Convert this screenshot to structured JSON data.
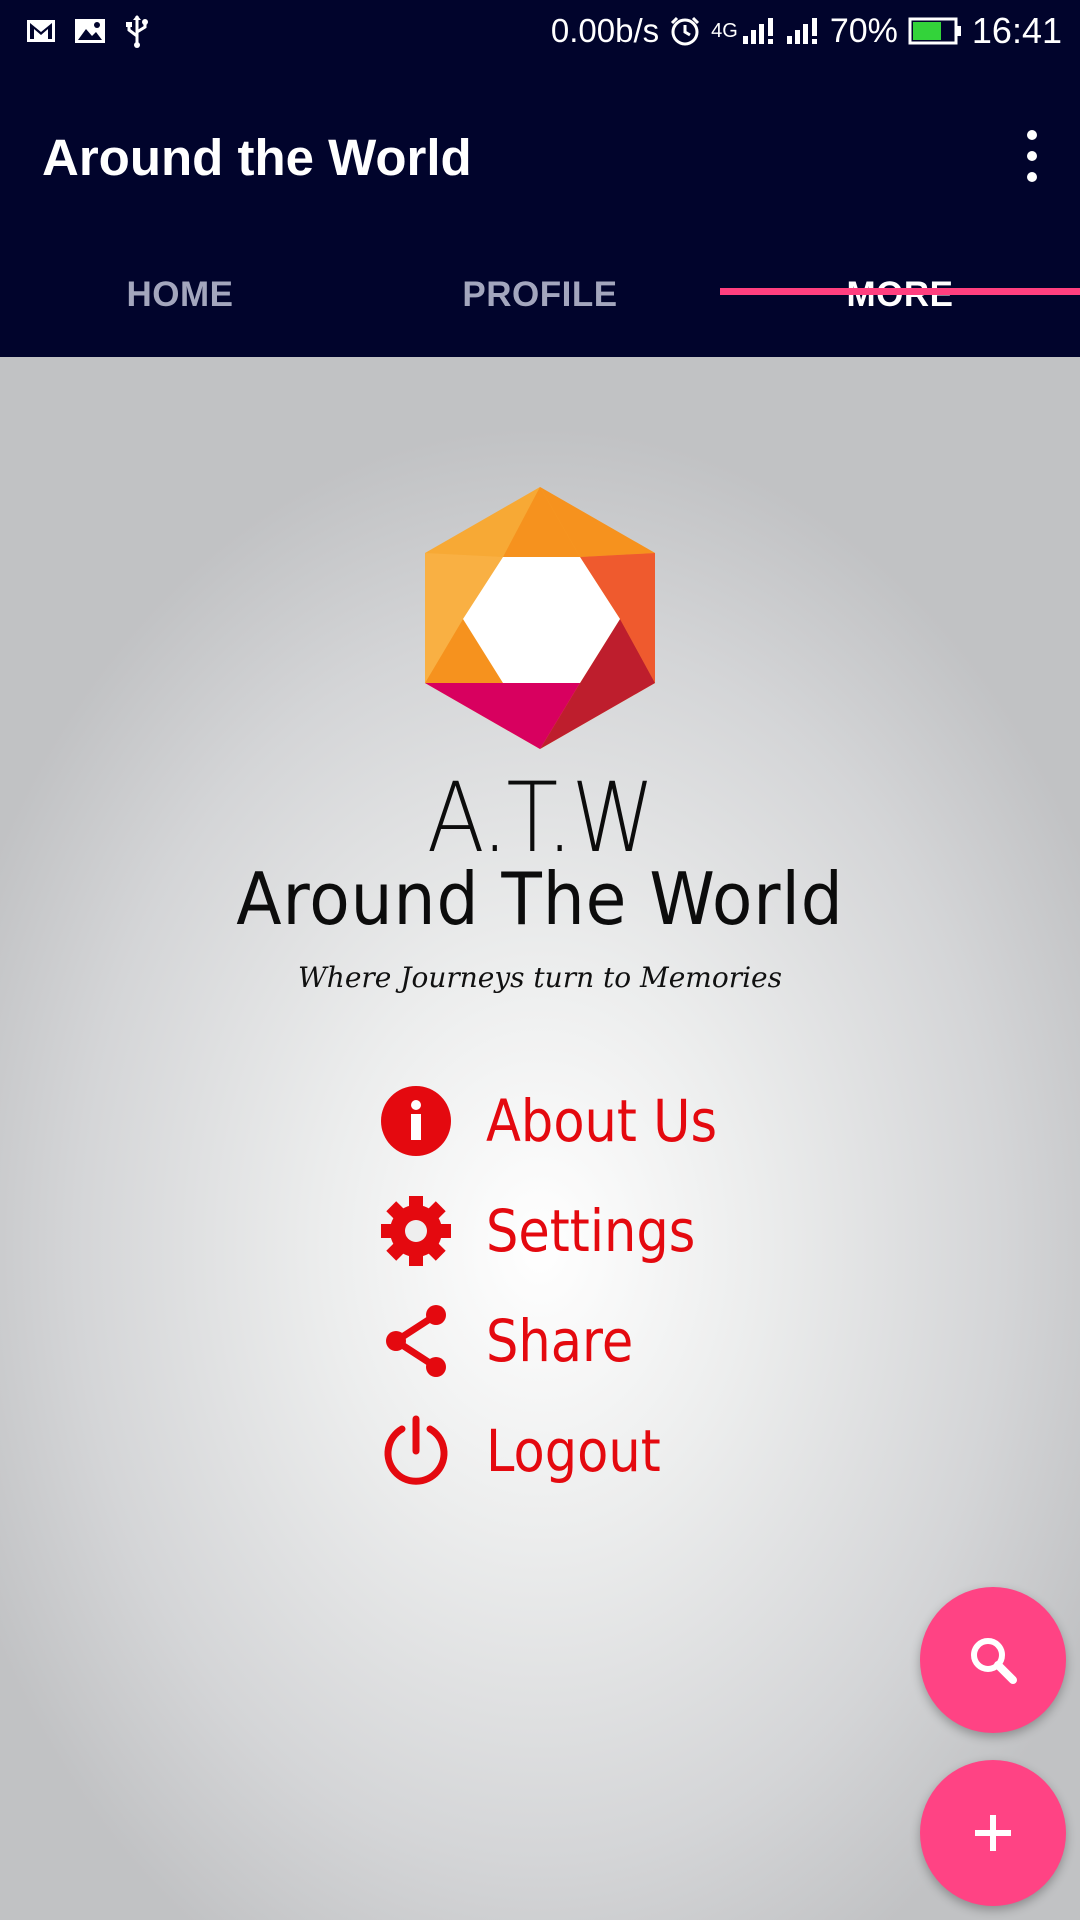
{
  "status_bar": {
    "icons": [
      "gmail-icon",
      "image-icon",
      "usb-icon"
    ],
    "net_speed": "0.00b/s",
    "network": "4G",
    "battery_percent": "70%",
    "battery_level": 0.7,
    "time": "16:41"
  },
  "app_bar": {
    "title": "Around the World",
    "overflow_icon": "more-vert-icon"
  },
  "tabs": [
    {
      "label": "HOME",
      "active": false
    },
    {
      "label": "PROFILE",
      "active": false
    },
    {
      "label": "MORE",
      "active": true
    }
  ],
  "brand": {
    "abbr": "A.T.W",
    "name": "Around The  World",
    "tagline": "Where Journeys turn to Memories"
  },
  "menu": [
    {
      "label": "About Us",
      "icon": "info-icon"
    },
    {
      "label": "Settings",
      "icon": "gear-icon"
    },
    {
      "label": "Share",
      "icon": "share-icon"
    },
    {
      "label": "Logout",
      "icon": "power-icon"
    }
  ],
  "fabs": [
    {
      "icon": "search-icon"
    },
    {
      "icon": "plus-icon"
    }
  ],
  "colors": {
    "app_bar": "#01042c",
    "accent": "#ff4384",
    "menu_red": "#e4090f",
    "tab_inactive": "#a3a6bd"
  }
}
